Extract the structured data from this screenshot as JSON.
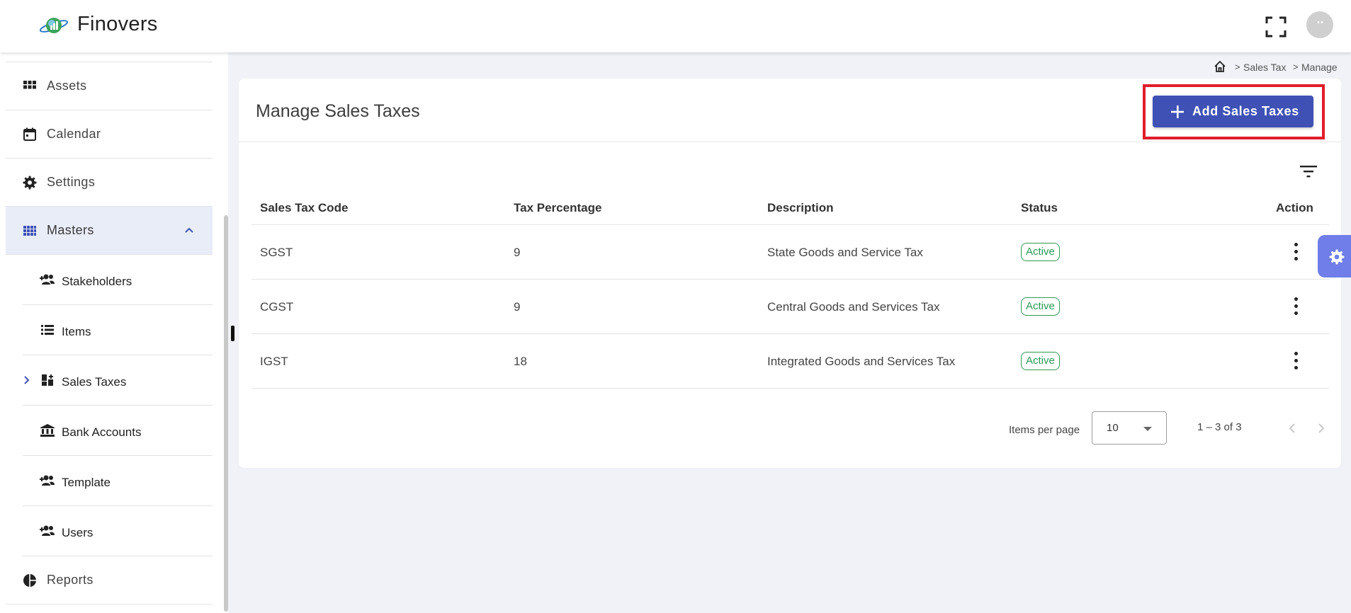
{
  "header": {
    "app_title": "Finovers"
  },
  "sidebar": {
    "items": [
      {
        "label": "Assets",
        "icon": "grid-icon"
      },
      {
        "label": "Calendar",
        "icon": "calendar-icon"
      },
      {
        "label": "Settings",
        "icon": "gear-icon"
      },
      {
        "label": "Masters",
        "icon": "apps-grid-icon",
        "expanded": true
      },
      {
        "label": "Reports",
        "icon": "pie-chart-icon"
      }
    ],
    "masters_children": [
      {
        "label": "Stakeholders",
        "icon": "person-add-icon"
      },
      {
        "label": "Items",
        "icon": "list-icon"
      },
      {
        "label": "Sales Taxes",
        "icon": "dashboard-add-icon",
        "selected": true
      },
      {
        "label": "Bank Accounts",
        "icon": "bank-icon"
      },
      {
        "label": "Template",
        "icon": "person-add-icon"
      },
      {
        "label": "Users",
        "icon": "person-add-icon"
      }
    ]
  },
  "breadcrumb": {
    "items": [
      "Sales Tax",
      "Manage"
    ]
  },
  "page": {
    "title": "Manage Sales Taxes",
    "add_button_label": "Add Sales Taxes"
  },
  "table": {
    "columns": [
      "Sales Tax Code",
      "Tax Percentage",
      "Description",
      "Status",
      "Action"
    ],
    "rows": [
      {
        "code": "SGST",
        "percentage": "9",
        "description": "State Goods and Service Tax",
        "status": "Active"
      },
      {
        "code": "CGST",
        "percentage": "9",
        "description": "Central Goods and Services Tax",
        "status": "Active"
      },
      {
        "code": "IGST",
        "percentage": "18",
        "description": "Integrated Goods and Services Tax",
        "status": "Active"
      }
    ]
  },
  "paginator": {
    "items_per_page_label": "Items per page",
    "items_per_page_value": "10",
    "range_label": "1 – 3 of 3"
  },
  "colors": {
    "primary": "#3f51b5",
    "highlight": "#e11d2a",
    "status_active": "#2e9a55",
    "fab": "#6f7ee8"
  }
}
